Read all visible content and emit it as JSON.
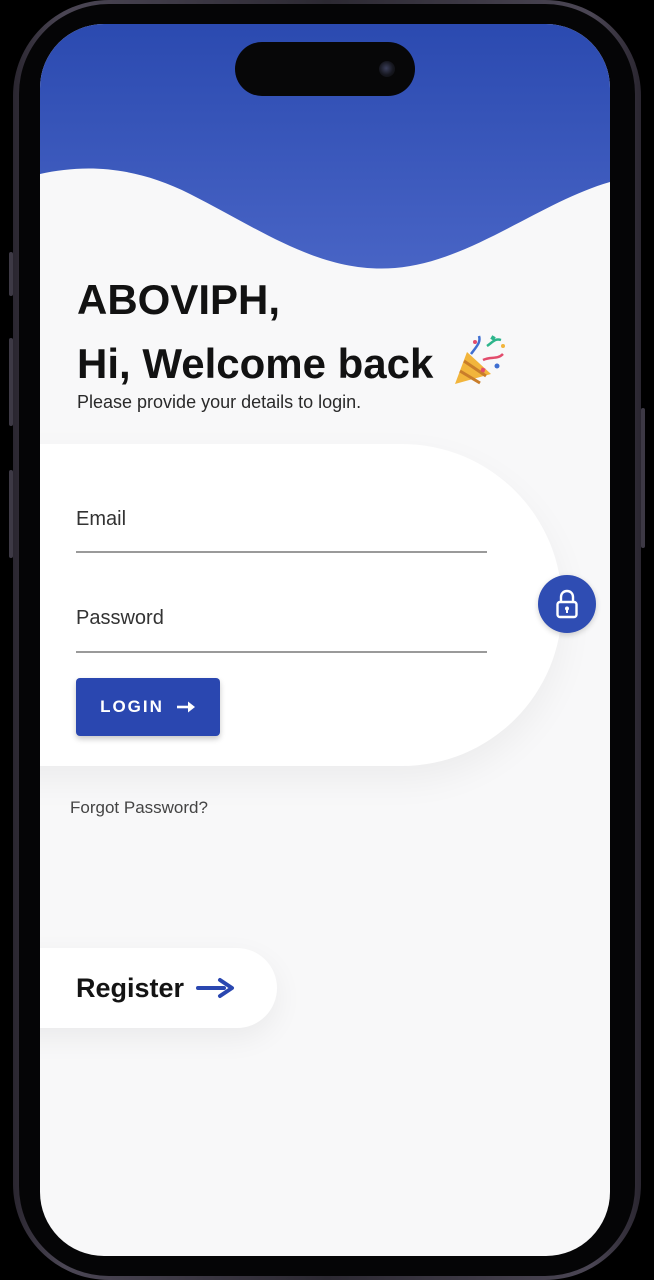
{
  "app": {
    "brand": "ABOVIPH,",
    "welcome": "Hi, Welcome back",
    "subtitle": "Please provide your details to login."
  },
  "form": {
    "email_label": "Email",
    "password_label": "Password",
    "login_label": "LOGIN"
  },
  "links": {
    "forgot": "Forgot Password?",
    "register": "Register"
  },
  "icons": {
    "welcome": "party-popper-icon",
    "login": "arrow-right-icon",
    "fab": "lock-icon",
    "register": "arrow-right-icon"
  },
  "colors": {
    "primary": "#2a47b0",
    "header_top": "#2b4ab0",
    "header_bottom": "#4763c4",
    "background": "#f8f8f9",
    "card": "#ffffff"
  }
}
